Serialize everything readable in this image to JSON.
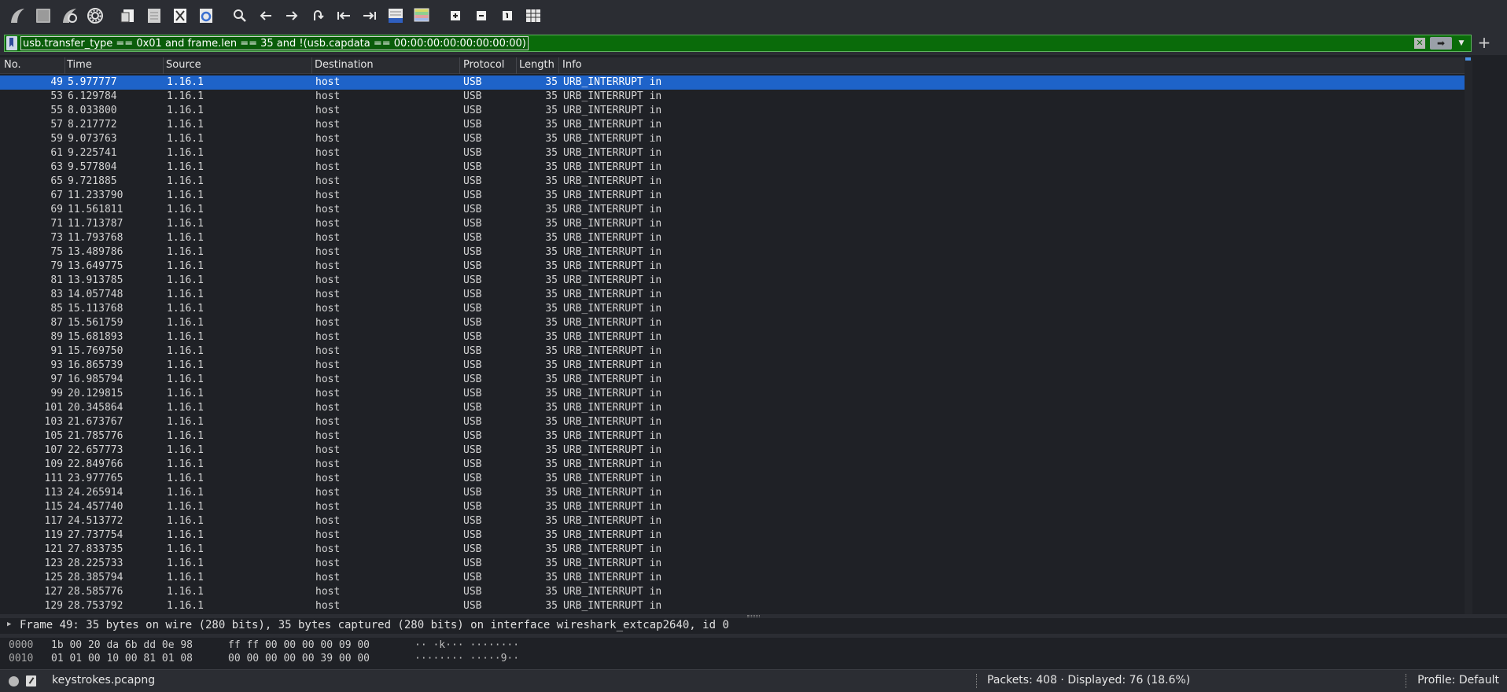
{
  "toolbar": {
    "buttons": [
      "start-capture-icon",
      "stop-capture-icon",
      "restart-capture-icon",
      "capture-options-icon",
      "open-file-icon",
      "save-file-icon",
      "close-file-icon",
      "reload-file-icon",
      "find-packet-icon",
      "go-back-icon",
      "go-forward-icon",
      "go-to-packet-icon",
      "go-first-icon",
      "go-last-icon",
      "autoscroll-icon",
      "colorize-icon",
      "zoom-in-icon",
      "zoom-out-icon",
      "zoom-normal-icon",
      "resize-columns-icon"
    ]
  },
  "filter": {
    "expression": "usb.transfer_type == 0x01 and frame.len == 35 and !(usb.capdata == 00:00:00:00:00:00:00:00)",
    "color": "#0a6b0a"
  },
  "columns": {
    "no": "No.",
    "time": "Time",
    "source": "Source",
    "destination": "Destination",
    "protocol": "Protocol",
    "length": "Length",
    "info": "Info"
  },
  "packets": [
    {
      "no": "49",
      "time": "5.977777",
      "src": "1.16.1",
      "dst": "host",
      "proto": "USB",
      "len": "35",
      "info": "URB_INTERRUPT in",
      "selected": true
    },
    {
      "no": "53",
      "time": "6.129784",
      "src": "1.16.1",
      "dst": "host",
      "proto": "USB",
      "len": "35",
      "info": "URB_INTERRUPT in"
    },
    {
      "no": "55",
      "time": "8.033800",
      "src": "1.16.1",
      "dst": "host",
      "proto": "USB",
      "len": "35",
      "info": "URB_INTERRUPT in"
    },
    {
      "no": "57",
      "time": "8.217772",
      "src": "1.16.1",
      "dst": "host",
      "proto": "USB",
      "len": "35",
      "info": "URB_INTERRUPT in"
    },
    {
      "no": "59",
      "time": "9.073763",
      "src": "1.16.1",
      "dst": "host",
      "proto": "USB",
      "len": "35",
      "info": "URB_INTERRUPT in"
    },
    {
      "no": "61",
      "time": "9.225741",
      "src": "1.16.1",
      "dst": "host",
      "proto": "USB",
      "len": "35",
      "info": "URB_INTERRUPT in"
    },
    {
      "no": "63",
      "time": "9.577804",
      "src": "1.16.1",
      "dst": "host",
      "proto": "USB",
      "len": "35",
      "info": "URB_INTERRUPT in"
    },
    {
      "no": "65",
      "time": "9.721885",
      "src": "1.16.1",
      "dst": "host",
      "proto": "USB",
      "len": "35",
      "info": "URB_INTERRUPT in"
    },
    {
      "no": "67",
      "time": "11.233790",
      "src": "1.16.1",
      "dst": "host",
      "proto": "USB",
      "len": "35",
      "info": "URB_INTERRUPT in"
    },
    {
      "no": "69",
      "time": "11.561811",
      "src": "1.16.1",
      "dst": "host",
      "proto": "USB",
      "len": "35",
      "info": "URB_INTERRUPT in"
    },
    {
      "no": "71",
      "time": "11.713787",
      "src": "1.16.1",
      "dst": "host",
      "proto": "USB",
      "len": "35",
      "info": "URB_INTERRUPT in"
    },
    {
      "no": "73",
      "time": "11.793768",
      "src": "1.16.1",
      "dst": "host",
      "proto": "USB",
      "len": "35",
      "info": "URB_INTERRUPT in"
    },
    {
      "no": "75",
      "time": "13.489786",
      "src": "1.16.1",
      "dst": "host",
      "proto": "USB",
      "len": "35",
      "info": "URB_INTERRUPT in"
    },
    {
      "no": "79",
      "time": "13.649775",
      "src": "1.16.1",
      "dst": "host",
      "proto": "USB",
      "len": "35",
      "info": "URB_INTERRUPT in"
    },
    {
      "no": "81",
      "time": "13.913785",
      "src": "1.16.1",
      "dst": "host",
      "proto": "USB",
      "len": "35",
      "info": "URB_INTERRUPT in"
    },
    {
      "no": "83",
      "time": "14.057748",
      "src": "1.16.1",
      "dst": "host",
      "proto": "USB",
      "len": "35",
      "info": "URB_INTERRUPT in"
    },
    {
      "no": "85",
      "time": "15.113768",
      "src": "1.16.1",
      "dst": "host",
      "proto": "USB",
      "len": "35",
      "info": "URB_INTERRUPT in"
    },
    {
      "no": "87",
      "time": "15.561759",
      "src": "1.16.1",
      "dst": "host",
      "proto": "USB",
      "len": "35",
      "info": "URB_INTERRUPT in"
    },
    {
      "no": "89",
      "time": "15.681893",
      "src": "1.16.1",
      "dst": "host",
      "proto": "USB",
      "len": "35",
      "info": "URB_INTERRUPT in"
    },
    {
      "no": "91",
      "time": "15.769750",
      "src": "1.16.1",
      "dst": "host",
      "proto": "USB",
      "len": "35",
      "info": "URB_INTERRUPT in"
    },
    {
      "no": "93",
      "time": "16.865739",
      "src": "1.16.1",
      "dst": "host",
      "proto": "USB",
      "len": "35",
      "info": "URB_INTERRUPT in"
    },
    {
      "no": "97",
      "time": "16.985794",
      "src": "1.16.1",
      "dst": "host",
      "proto": "USB",
      "len": "35",
      "info": "URB_INTERRUPT in"
    },
    {
      "no": "99",
      "time": "20.129815",
      "src": "1.16.1",
      "dst": "host",
      "proto": "USB",
      "len": "35",
      "info": "URB_INTERRUPT in"
    },
    {
      "no": "101",
      "time": "20.345864",
      "src": "1.16.1",
      "dst": "host",
      "proto": "USB",
      "len": "35",
      "info": "URB_INTERRUPT in"
    },
    {
      "no": "103",
      "time": "21.673767",
      "src": "1.16.1",
      "dst": "host",
      "proto": "USB",
      "len": "35",
      "info": "URB_INTERRUPT in"
    },
    {
      "no": "105",
      "time": "21.785776",
      "src": "1.16.1",
      "dst": "host",
      "proto": "USB",
      "len": "35",
      "info": "URB_INTERRUPT in"
    },
    {
      "no": "107",
      "time": "22.657773",
      "src": "1.16.1",
      "dst": "host",
      "proto": "USB",
      "len": "35",
      "info": "URB_INTERRUPT in"
    },
    {
      "no": "109",
      "time": "22.849766",
      "src": "1.16.1",
      "dst": "host",
      "proto": "USB",
      "len": "35",
      "info": "URB_INTERRUPT in"
    },
    {
      "no": "111",
      "time": "23.977765",
      "src": "1.16.1",
      "dst": "host",
      "proto": "USB",
      "len": "35",
      "info": "URB_INTERRUPT in"
    },
    {
      "no": "113",
      "time": "24.265914",
      "src": "1.16.1",
      "dst": "host",
      "proto": "USB",
      "len": "35",
      "info": "URB_INTERRUPT in"
    },
    {
      "no": "115",
      "time": "24.457740",
      "src": "1.16.1",
      "dst": "host",
      "proto": "USB",
      "len": "35",
      "info": "URB_INTERRUPT in"
    },
    {
      "no": "117",
      "time": "24.513772",
      "src": "1.16.1",
      "dst": "host",
      "proto": "USB",
      "len": "35",
      "info": "URB_INTERRUPT in"
    },
    {
      "no": "119",
      "time": "27.737754",
      "src": "1.16.1",
      "dst": "host",
      "proto": "USB",
      "len": "35",
      "info": "URB_INTERRUPT in"
    },
    {
      "no": "121",
      "time": "27.833735",
      "src": "1.16.1",
      "dst": "host",
      "proto": "USB",
      "len": "35",
      "info": "URB_INTERRUPT in"
    },
    {
      "no": "123",
      "time": "28.225733",
      "src": "1.16.1",
      "dst": "host",
      "proto": "USB",
      "len": "35",
      "info": "URB_INTERRUPT in"
    },
    {
      "no": "125",
      "time": "28.385794",
      "src": "1.16.1",
      "dst": "host",
      "proto": "USB",
      "len": "35",
      "info": "URB_INTERRUPT in"
    },
    {
      "no": "127",
      "time": "28.585776",
      "src": "1.16.1",
      "dst": "host",
      "proto": "USB",
      "len": "35",
      "info": "URB_INTERRUPT in"
    },
    {
      "no": "129",
      "time": "28.753792",
      "src": "1.16.1",
      "dst": "host",
      "proto": "USB",
      "len": "35",
      "info": "URB_INTERRUPT in"
    }
  ],
  "details": {
    "frame_summary": "Frame 49: 35 bytes on wire (280 bits), 35 bytes captured (280 bits) on interface wireshark_extcap2640, id 0"
  },
  "bytes": [
    {
      "offset": "0000",
      "hex1": "1b 00 20 da 6b dd 0e 98",
      "hex2": "ff ff 00 00 00 00 09 00",
      "ascii": "·· ·k··· ········"
    },
    {
      "offset": "0010",
      "hex1": "01 01 00 10 00 81 01 08",
      "hex2": "00 00 00 00 00 39 00 00",
      "ascii": "········ ·····9··"
    }
  ],
  "status": {
    "file": "keystrokes.pcapng",
    "packets": "Packets: 408 · Displayed: 76 (18.6%)",
    "profile": "Profile: Default"
  },
  "colors": {
    "selection": "#1e63c9",
    "filter_valid": "#0a6b0a",
    "background": "#1f2126"
  }
}
